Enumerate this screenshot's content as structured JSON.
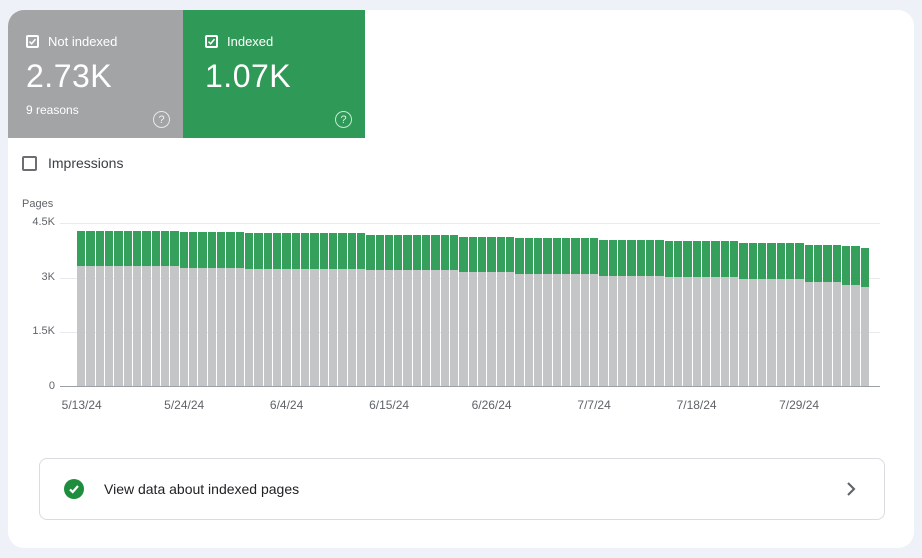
{
  "colors": {
    "page_bg": "#eef1f7",
    "panel_bg": "#ffffff",
    "card_gray": "#a3a4a6",
    "card_green": "#2f9a57",
    "bar_gray": "#c4c5c6",
    "bar_green": "#34a05c",
    "check_green": "#1e8e3e",
    "text_gray": "#5f6368",
    "text_dark": "#202124",
    "grid": "#e9eaed",
    "axis": "#9aa0a6",
    "border": "#dadce0"
  },
  "icons": {
    "help": "?"
  },
  "summary_cards": [
    {
      "id": "not-indexed",
      "label": "Not indexed",
      "value": "2.73K",
      "sub": "9 reasons",
      "checked": true
    },
    {
      "id": "indexed",
      "label": "Indexed",
      "value": "1.07K",
      "sub": "",
      "checked": true
    }
  ],
  "impressions_toggle": {
    "label": "Impressions",
    "checked": false
  },
  "chart_data": {
    "type": "bar",
    "stacked": true,
    "title": "",
    "ylabel": "Pages",
    "xlabel": "",
    "ylim": [
      0,
      4500
    ],
    "grid": true,
    "legend_position": "cards-top-left",
    "y_ticks": [
      {
        "label": "4.5K",
        "value": 4500
      },
      {
        "label": "3K",
        "value": 3000
      },
      {
        "label": "1.5K",
        "value": 1500
      },
      {
        "label": "0",
        "value": 0
      }
    ],
    "x_ticks": [
      {
        "index": 0,
        "label": "5/13/24"
      },
      {
        "index": 11,
        "label": "5/24/24"
      },
      {
        "index": 22,
        "label": "6/4/24"
      },
      {
        "index": 33,
        "label": "6/15/24"
      },
      {
        "index": 44,
        "label": "6/26/24"
      },
      {
        "index": 55,
        "label": "7/7/24"
      },
      {
        "index": 66,
        "label": "7/18/24"
      },
      {
        "index": 77,
        "label": "7/29/24"
      }
    ],
    "series": [
      {
        "name": "Not indexed",
        "color": "#c4c5c6",
        "values": [
          3280,
          3280,
          3280,
          3280,
          3280,
          3280,
          3280,
          3280,
          3280,
          3280,
          3280,
          3240,
          3240,
          3240,
          3240,
          3240,
          3240,
          3240,
          3200,
          3200,
          3200,
          3200,
          3200,
          3200,
          3200,
          3200,
          3200,
          3200,
          3200,
          3200,
          3200,
          3170,
          3170,
          3170,
          3170,
          3170,
          3170,
          3170,
          3170,
          3170,
          3170,
          3120,
          3120,
          3120,
          3120,
          3120,
          3120,
          3080,
          3080,
          3080,
          3080,
          3080,
          3080,
          3080,
          3080,
          3080,
          3030,
          3030,
          3030,
          3030,
          3030,
          3030,
          3030,
          2980,
          2980,
          2980,
          2980,
          2980,
          2980,
          2980,
          2980,
          2930,
          2930,
          2930,
          2930,
          2930,
          2930,
          2930,
          2850,
          2850,
          2850,
          2850,
          2760,
          2760,
          2730
        ]
      },
      {
        "name": "Indexed",
        "color": "#34a05c",
        "values": [
          970,
          970,
          970,
          970,
          970,
          970,
          970,
          970,
          970,
          970,
          970,
          990,
          990,
          990,
          990,
          990,
          990,
          990,
          990,
          990,
          990,
          990,
          990,
          990,
          990,
          990,
          990,
          990,
          990,
          990,
          990,
          980,
          980,
          980,
          980,
          980,
          980,
          980,
          980,
          980,
          980,
          980,
          980,
          980,
          980,
          980,
          980,
          980,
          980,
          980,
          980,
          980,
          980,
          980,
          980,
          980,
          980,
          980,
          980,
          980,
          980,
          980,
          980,
          990,
          990,
          990,
          990,
          990,
          990,
          990,
          990,
          1000,
          1000,
          1000,
          1000,
          1000,
          1000,
          1000,
          1030,
          1030,
          1030,
          1030,
          1070,
          1070,
          1070
        ]
      }
    ]
  },
  "footer_banner": {
    "text": "View data about indexed pages"
  }
}
